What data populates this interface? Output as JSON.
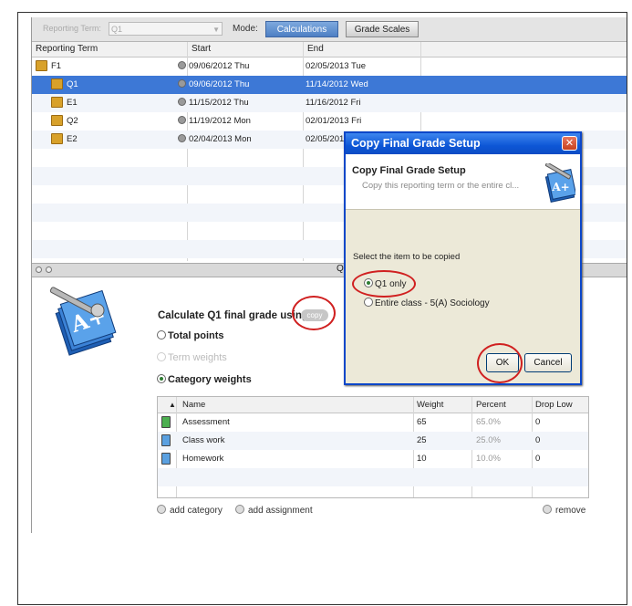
{
  "toolbar": {
    "reporting_term_label": "Reporting Term:",
    "reporting_term_value": "Q1",
    "mode_label": "Mode:",
    "modes": [
      {
        "label": "Calculations",
        "active": true
      },
      {
        "label": "Grade Scales",
        "active": false
      }
    ]
  },
  "terms_grid": {
    "columns": [
      "Reporting Term",
      "Start",
      "End"
    ],
    "rows": [
      {
        "name": "F1",
        "start": "09/06/2012 Thu",
        "end": "02/05/2013 Tue",
        "level": 0,
        "selected": false
      },
      {
        "name": "Q1",
        "start": "09/06/2012 Thu",
        "end": "11/14/2012 Wed",
        "level": 1,
        "selected": true
      },
      {
        "name": "E1",
        "start": "11/15/2012 Thu",
        "end": "11/16/2012 Fri",
        "level": 1,
        "selected": false
      },
      {
        "name": "Q2",
        "start": "11/19/2012 Mon",
        "end": "02/01/2013 Fri",
        "level": 1,
        "selected": false
      },
      {
        "name": "E2",
        "start": "02/04/2013 Mon",
        "end": "02/05/2013",
        "level": 1,
        "selected": false
      }
    ]
  },
  "divider": {
    "title": "Q"
  },
  "calculation": {
    "label": "Calculate Q1 final grade using:",
    "copy_button": "copy",
    "options": [
      {
        "label": "Total points",
        "checked": false,
        "disabled": false
      },
      {
        "label": "Term weights",
        "checked": false,
        "disabled": true
      },
      {
        "label": "Category weights",
        "checked": true,
        "disabled": false
      }
    ]
  },
  "categories": {
    "sort_glyph": "▲",
    "columns": [
      "Name",
      "Weight",
      "Percent",
      "Drop Low"
    ],
    "rows": [
      {
        "name": "Assessment",
        "weight": "65",
        "percent": "65.0%",
        "drop_low": "0",
        "color": "#4caf50"
      },
      {
        "name": "Class work",
        "weight": "25",
        "percent": "25.0%",
        "drop_low": "0",
        "color": "#5aa0e0"
      },
      {
        "name": "Homework",
        "weight": "10",
        "percent": "10.0%",
        "drop_low": "0",
        "color": "#5aa0e0"
      }
    ]
  },
  "footer": {
    "add_category": "add category",
    "add_assignment": "add assignment",
    "remove": "remove"
  },
  "dialog": {
    "title": "Copy Final Grade Setup",
    "close_glyph": "✕",
    "heading": "Copy Final Grade Setup",
    "description": "Copy this reporting term or the entire cl...",
    "prompt": "Select the item to be copied",
    "options": [
      {
        "label": "Q1 only",
        "checked": true
      },
      {
        "label": "Entire class - 5(A) Sociology",
        "checked": false
      }
    ],
    "ok": "OK",
    "cancel": "Cancel"
  },
  "colors": {
    "accent": "#3d78d6",
    "dialog_title": "#0d56d6",
    "annotation": "#d02020"
  }
}
